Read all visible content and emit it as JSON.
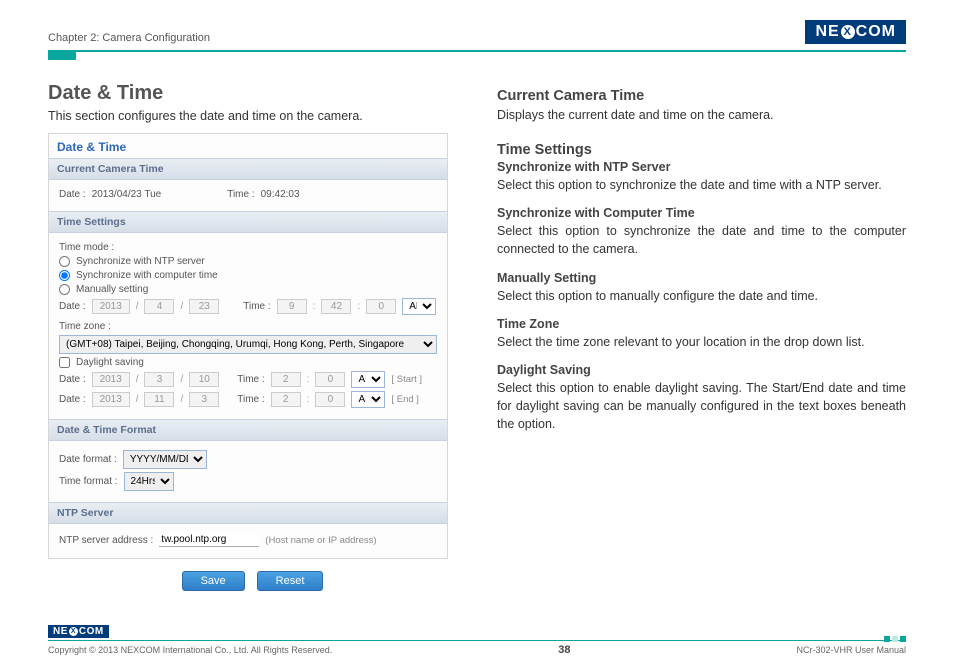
{
  "header": {
    "chapter": "Chapter 2: Camera Configuration",
    "logo_pre": "NE",
    "logo_x": "X",
    "logo_post": "COM"
  },
  "left": {
    "h1": "Date & Time",
    "intro": "This section configures the date and time on the camera.",
    "panel_title": "Date & Time",
    "g_current": "Current Camera Time",
    "date_label": "Date :",
    "date_value": "2013/04/23 Tue",
    "time_label": "Time :",
    "time_value": "09:42:03",
    "g_settings": "Time Settings",
    "time_mode": "Time mode :",
    "opt_ntp": "Synchronize with NTP server",
    "opt_comp": "Synchronize with computer time",
    "opt_manual": "Manually setting",
    "m_year": "2013",
    "m_mon": "4",
    "m_day": "23",
    "m_hh": "9",
    "m_mm": "42",
    "m_ss": "0",
    "m_ampm": "AM",
    "tz_label": "Time zone :",
    "tz_value": "(GMT+08) Taipei, Beijing, Chongqing, Urumqi, Hong Kong, Perth, Singapore",
    "dls_label": "Daylight saving",
    "d1_y": "2013",
    "d1_m": "3",
    "d1_d": "10",
    "d1_hh": "2",
    "d1_mm": "0",
    "d1_ampm": "AM",
    "start": "[ Start ]",
    "d2_y": "2013",
    "d2_m": "11",
    "d2_d": "3",
    "d2_hh": "2",
    "d2_mm": "0",
    "d2_ampm": "AM",
    "end": "[ End ]",
    "g_format": "Date & Time Format",
    "datefmt_label": "Date format :",
    "datefmt_value": "YYYY/MM/DD",
    "timefmt_label": "Time format :",
    "timefmt_value": "24Hrs",
    "g_ntp": "NTP Server",
    "ntp_label": "NTP server address :",
    "ntp_value": "tw.pool.ntp.org",
    "ntp_hint": "(Host name or IP address)",
    "save": "Save",
    "reset": "Reset"
  },
  "right": {
    "cct_h": "Current Camera Time",
    "cct_d": "Displays the current date and time on the camera.",
    "ts_h": "Time Settings",
    "ntp_h": "Synchronize with NTP Server",
    "ntp_d": "Select this option to synchronize the date and time with a NTP server.",
    "comp_h": "Synchronize with Computer Time",
    "comp_d": "Select this option to synchronize the date and time to the computer connected to the camera.",
    "man_h": "Manually Setting",
    "man_d": "Select this option to manually configure the date and time.",
    "tz_h": "Time Zone",
    "tz_d": "Select the time zone relevant to your location in the drop down list.",
    "dls_h": "Daylight Saving",
    "dls_d": "Select this option to enable daylight saving. The Start/End date and time for daylight saving can be manually configured in the text boxes beneath the option."
  },
  "footer": {
    "copyright": "Copyright © 2013 NEXCOM International Co., Ltd. All Rights Reserved.",
    "page": "38",
    "docid": "NCr-302-VHR User Manual"
  }
}
